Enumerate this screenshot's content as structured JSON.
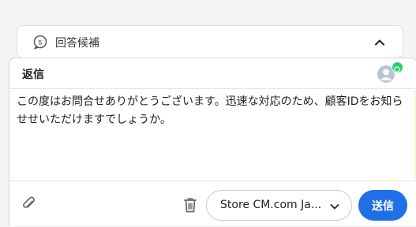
{
  "suggestions": {
    "title": "回答候補",
    "icon": "dollar-chat-icon",
    "toggle_icon": "chevron-up-icon"
  },
  "reply": {
    "title": "返信",
    "avatar_icon": "user-avatar-icon",
    "channel_icon": "whatsapp-icon",
    "message": "この度はお問合せありがとうございます。迅速な対応のため、顧客IDをお知らせせいただけますでしょうか。",
    "attach_icon": "paperclip-icon",
    "trash_icon": "trash-icon",
    "store_value": "Store CM.com Ja...",
    "send_label": "送信"
  },
  "colors": {
    "send_button": "#1f6fe6",
    "whatsapp": "#25d366",
    "avatar": "#b7c4d4"
  }
}
